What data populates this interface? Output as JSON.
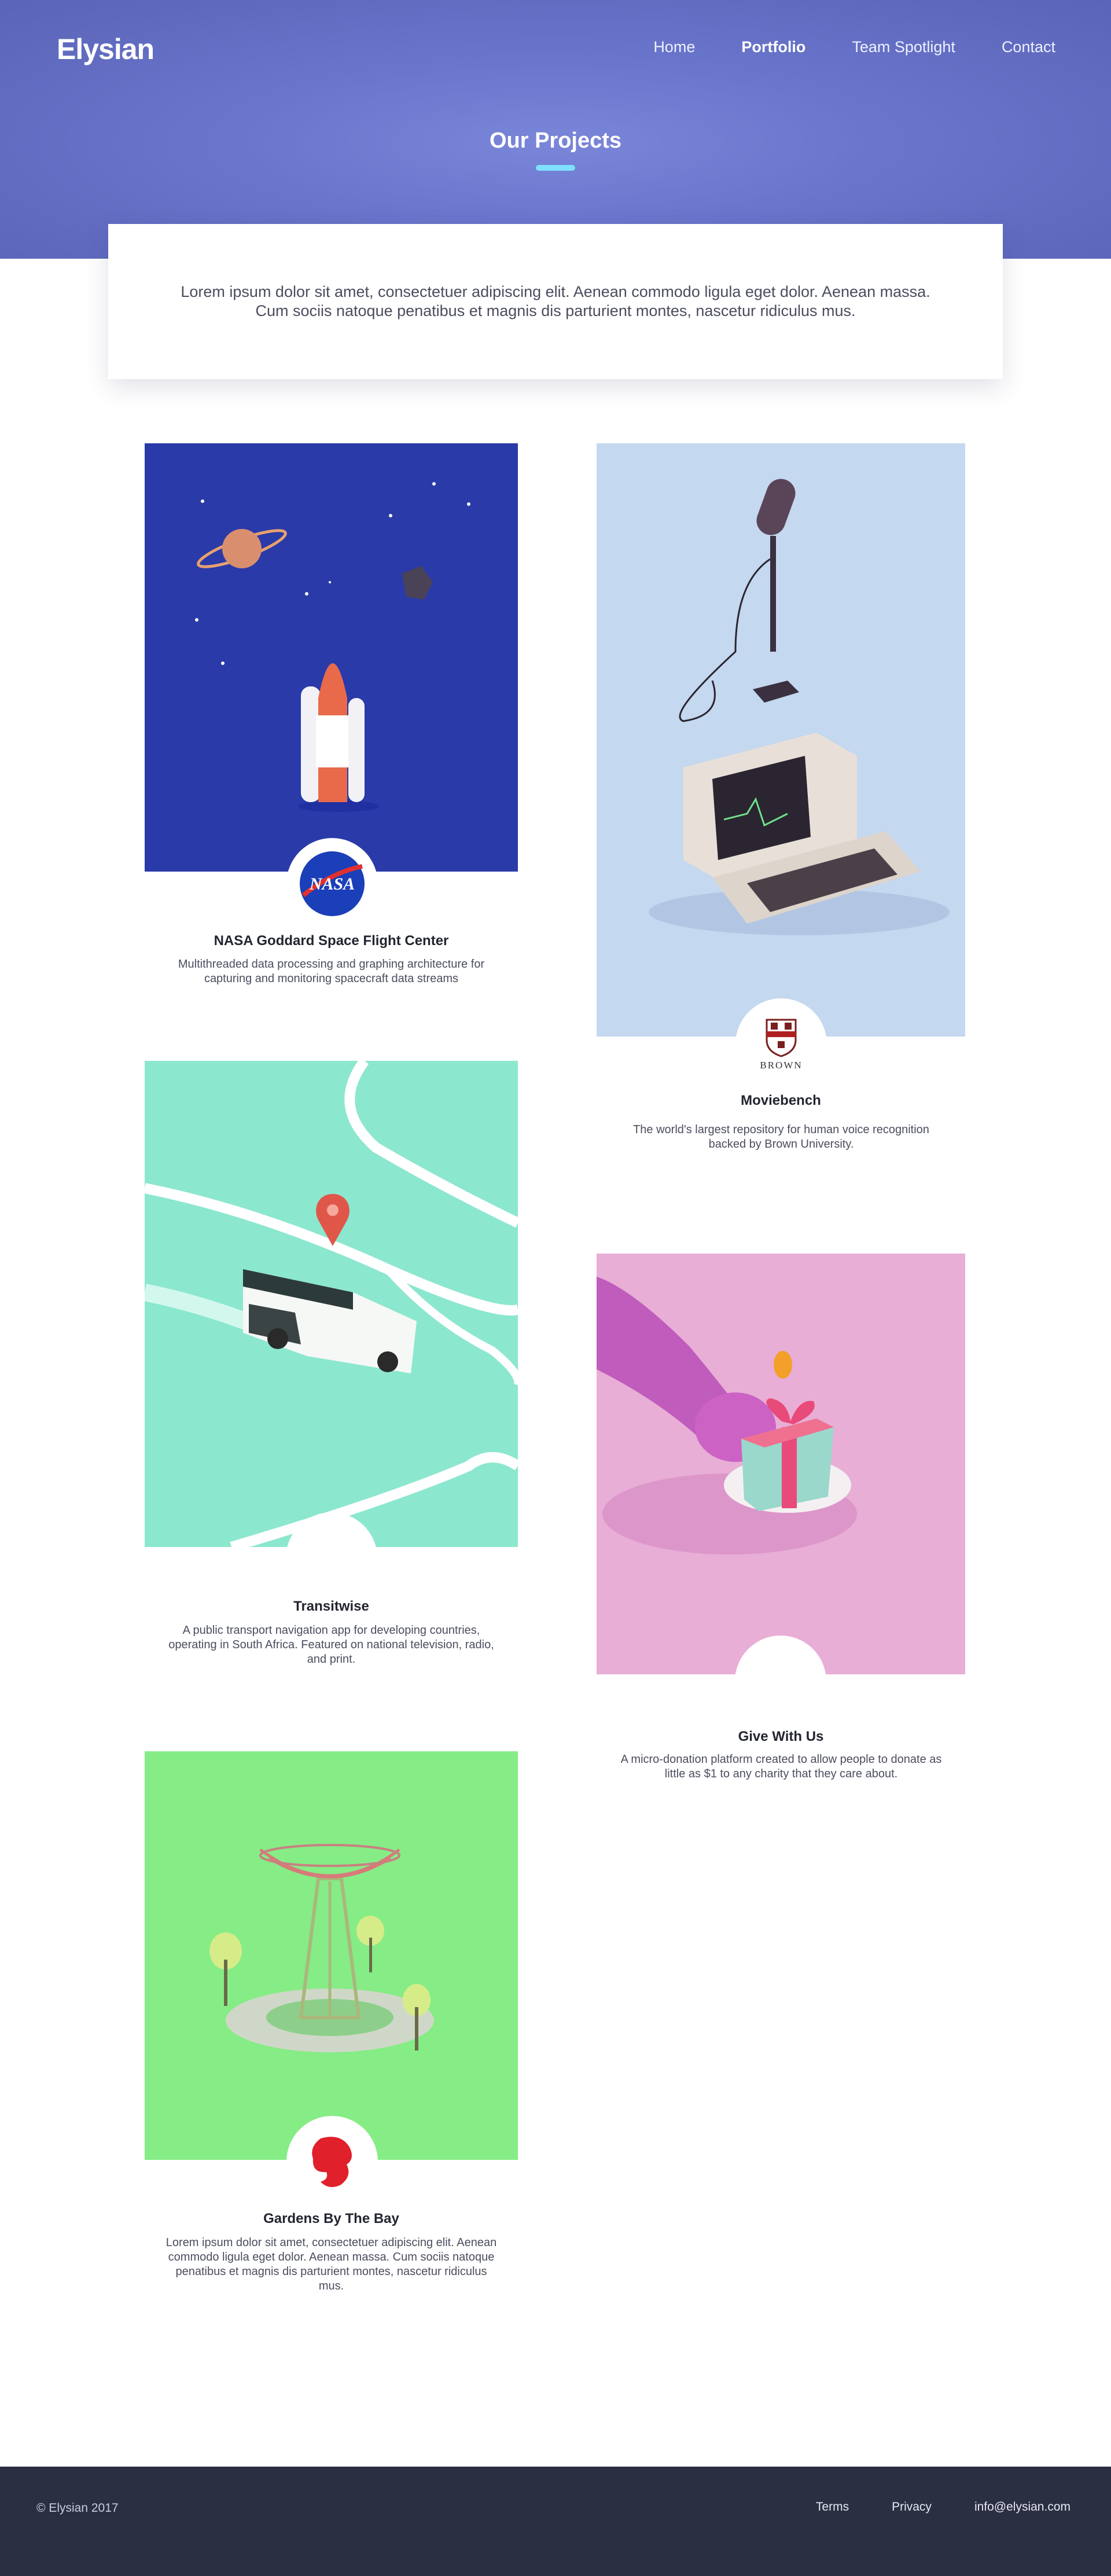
{
  "header": {
    "logo": "Elysian",
    "nav": [
      "Home",
      "Portfolio",
      "Team Spotlight",
      "Contact"
    ],
    "active": "Portfolio"
  },
  "hero": {
    "title": "Our Projects"
  },
  "intro": {
    "text": "Lorem ipsum dolor sit amet, consectetuer adipiscing elit. Aenean commodo ligula eget dolor. Aenean massa. Cum sociis natoque penatibus et magnis dis parturient montes, nascetur ridiculus mus."
  },
  "projects": [
    {
      "title": "NASA Goddard Space Flight Center",
      "description": "Multithreaded data processing and graphing architecture for capturing and monitoring spacecraft data streams",
      "badge_text": "NASA",
      "bg": "#2a3aa8"
    },
    {
      "title": "Moviebench",
      "description": "The world's largest repository for human voice recognition backed by Brown University.",
      "badge_text": "BROWN",
      "bg": "#c4d8ef"
    },
    {
      "title": "Transitwise",
      "description": "A public transport navigation app for developing countries, operating in South Africa. Featured on national television, radio, and print.",
      "bg": "#8ce7cf"
    },
    {
      "title": "Give With Us",
      "description": "A micro-donation platform created to allow people to donate as little as $1 to any charity that they care about.",
      "bg": "#e8aed6"
    },
    {
      "title": "Gardens By The Bay",
      "description": "Lorem ipsum dolor sit amet, consectetuer adipiscing elit. Aenean commodo ligula eget dolor. Aenean massa. Cum sociis natoque penatibus et magnis dis parturient montes, nascetur ridiculus mus.",
      "bg": "#86ec86"
    }
  ],
  "footer": {
    "copyright": "© Elysian 2017",
    "links": [
      "Terms",
      "Privacy",
      "info@elysian.com"
    ]
  }
}
